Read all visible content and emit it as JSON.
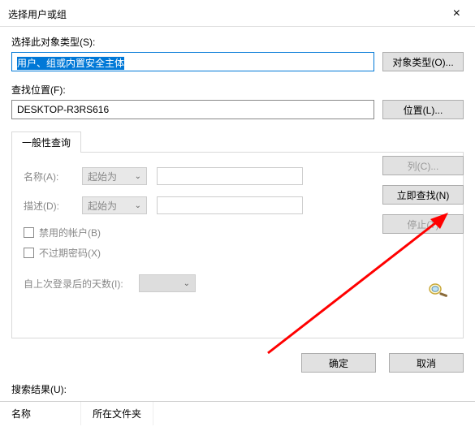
{
  "titlebar": {
    "title": "选择用户或组",
    "close": "×"
  },
  "objectType": {
    "label": "选择此对象类型(S):",
    "value": "用户、组或内置安全主体",
    "button": "对象类型(O)..."
  },
  "location": {
    "label": "查找位置(F):",
    "value": "DESKTOP-R3RS616",
    "button": "位置(L)..."
  },
  "tabs": {
    "general": "一般性查询"
  },
  "query": {
    "nameLabel": "名称(A):",
    "descLabel": "描述(D):",
    "comboOption": "起始为",
    "chkDisabled": "禁用的帐户(B)",
    "chkNoExpire": "不过期密码(X)",
    "daysLabel": "自上次登录后的天数(I):"
  },
  "sideButtons": {
    "columns": "列(C)...",
    "findNow": "立即查找(N)",
    "stop": "停止(T)"
  },
  "footer": {
    "ok": "确定",
    "cancel": "取消"
  },
  "results": {
    "label": "搜索结果(U):",
    "colName": "名称",
    "colFolder": "所在文件夹"
  }
}
